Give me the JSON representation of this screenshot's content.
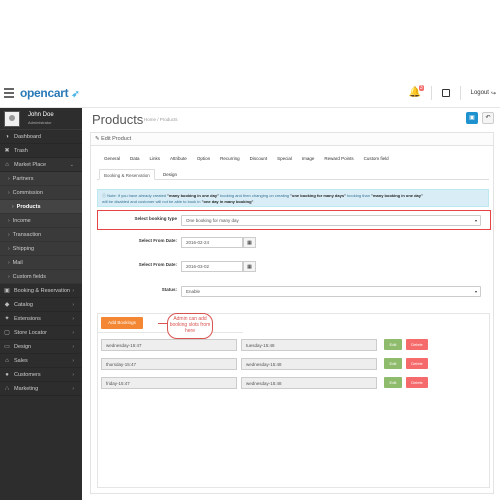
{
  "header": {
    "logo_text": "opencart",
    "logo_cart": "➶",
    "notification_count": "3",
    "logout_label": "Logout"
  },
  "sidebar": {
    "profile": {
      "name": "John Doe",
      "role": "Administrator"
    },
    "items": [
      {
        "label": "Dashboard",
        "icon": "dashboard-icon",
        "glyph": "◑"
      },
      {
        "label": "Trash",
        "icon": "trash-icon",
        "glyph": "✖"
      },
      {
        "label": "Market Place",
        "icon": "cart-icon",
        "glyph": "⌂"
      }
    ],
    "submenu": [
      {
        "label": "Partners"
      },
      {
        "label": "Commission"
      },
      {
        "label": "Products"
      },
      {
        "label": "Income"
      },
      {
        "label": "Transaction"
      },
      {
        "label": "Shipping"
      },
      {
        "label": "Mail"
      },
      {
        "label": "Custom fields"
      }
    ],
    "items_bottom": [
      {
        "label": "Booking & Reservation",
        "icon": "booking-icon",
        "glyph": "▣"
      },
      {
        "label": "Catalog",
        "icon": "tag-icon",
        "glyph": "◆"
      },
      {
        "label": "Extensions",
        "icon": "puzzle-icon",
        "glyph": "✦"
      },
      {
        "label": "Store Locator",
        "icon": "store-icon",
        "glyph": "▢"
      },
      {
        "label": "Design",
        "icon": "desktop-icon",
        "glyph": "▭"
      },
      {
        "label": "Sales",
        "icon": "sales-cart-icon",
        "glyph": "⌂"
      },
      {
        "label": "Customers",
        "icon": "user-icon",
        "glyph": "●"
      },
      {
        "label": "Marketing",
        "icon": "share-icon",
        "glyph": "∴"
      }
    ]
  },
  "page": {
    "title": "Products",
    "breadcrumb": "Home  /  Products",
    "panel_heading": "✎ Edit Product"
  },
  "tabs_row1": [
    "General",
    "Data",
    "Links",
    "Attribute",
    "Option",
    "Recurring",
    "Discount",
    "Special",
    "Image",
    "Reward Points",
    "Custom field"
  ],
  "tabs_row2": [
    "Booking & Reservation",
    "Design"
  ],
  "alert": {
    "line1_a": "ⓘ Note: If you have already created ",
    "line1_b": "\"many booking in one day\"",
    "line1_c": " booking and then changing on creating ",
    "line1_d": "\"one booking for many days\"",
    "line1_e": " booking than ",
    "line1_f": "\"many booking in one day\"",
    "line2_a": "will be disabled and customer will not be able to book in ",
    "line2_b": "\"one day in many booking\""
  },
  "form": {
    "booking_type_label": "Select booking type",
    "booking_type_value": "One booking for many day",
    "from_date_label": "Select From Date:",
    "from_date_value": "2016-02-24",
    "to_date_label": "Select From Date:",
    "to_date_value": "2016-03-02",
    "status_label": "Status:",
    "status_value": "Enable"
  },
  "add_bookings_label": "Add Bookings",
  "callout_text": "Admin can add booking slots from here",
  "slots": [
    {
      "from": "wednesday-15:47",
      "to": "tuesday-15:48"
    },
    {
      "from": "thursday-15:47",
      "to": "wednesday-15:48"
    },
    {
      "from": "friday-15:47",
      "to": "wednesday-15:48"
    }
  ],
  "edit_label": "Edit",
  "delete_label": "Delete"
}
